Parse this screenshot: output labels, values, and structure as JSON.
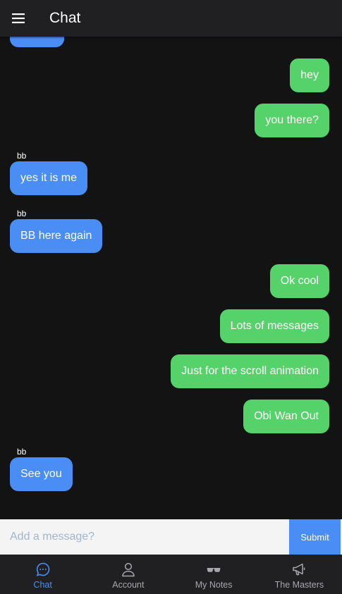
{
  "header": {
    "title": "Chat"
  },
  "messages": [
    {
      "dir": "in",
      "text": "",
      "sender": ""
    },
    {
      "dir": "out",
      "text": "hey"
    },
    {
      "dir": "out",
      "text": "you there?"
    },
    {
      "dir": "in",
      "text": "yes it is me",
      "sender": "bb"
    },
    {
      "dir": "in",
      "text": "BB here again",
      "sender": "bb"
    },
    {
      "dir": "out",
      "text": "Ok cool"
    },
    {
      "dir": "out",
      "text": "Lots of messages"
    },
    {
      "dir": "out",
      "text": "Just for the scroll animation"
    },
    {
      "dir": "out",
      "text": "Obi Wan Out"
    },
    {
      "dir": "in",
      "text": "See you",
      "sender": "bb"
    }
  ],
  "composer": {
    "placeholder": "Add a message?",
    "value": "",
    "submit_label": "Submit"
  },
  "tabs": [
    {
      "label": "Chat",
      "icon": "chat-bubble-icon",
      "active": true
    },
    {
      "label": "Account",
      "icon": "person-icon",
      "active": false
    },
    {
      "label": "My Notes",
      "icon": "glasses-icon",
      "active": false
    },
    {
      "label": "The Masters",
      "icon": "megaphone-icon",
      "active": false
    }
  ],
  "colors": {
    "outgoing": "#55d26a",
    "incoming": "#4a8ef5",
    "accent": "#4a8ef5",
    "background": "#131314"
  }
}
